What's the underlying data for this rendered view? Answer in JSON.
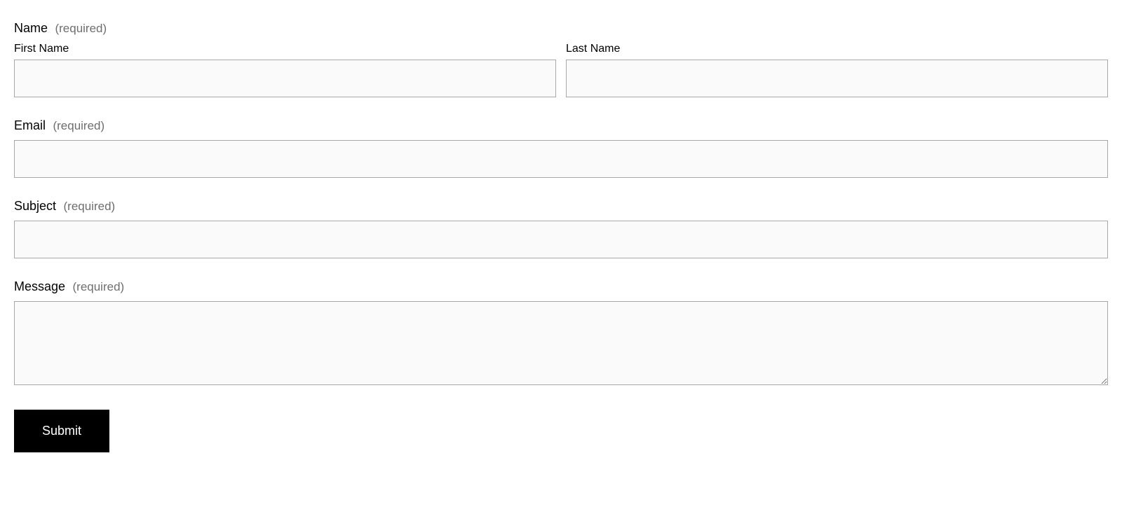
{
  "form": {
    "name": {
      "label": "Name",
      "required_text": "(required)",
      "first_name_label": "First Name",
      "last_name_label": "Last Name",
      "first_name_value": "",
      "last_name_value": ""
    },
    "email": {
      "label": "Email",
      "required_text": "(required)",
      "value": ""
    },
    "subject": {
      "label": "Subject",
      "required_text": "(required)",
      "value": ""
    },
    "message": {
      "label": "Message",
      "required_text": "(required)",
      "value": ""
    },
    "submit_label": "Submit"
  }
}
